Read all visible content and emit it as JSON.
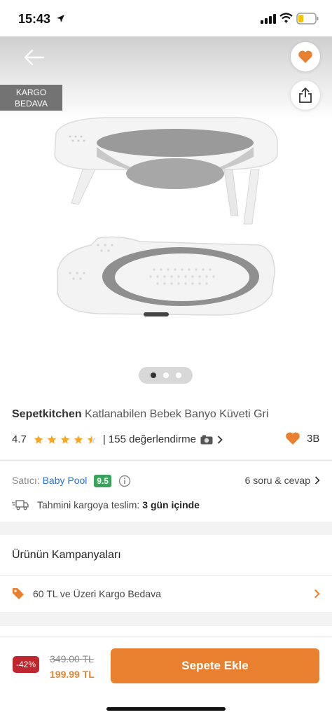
{
  "status": {
    "time": "15:43"
  },
  "hero": {
    "cargo_badge_line1": "KARGO",
    "cargo_badge_line2": "BEDAVA",
    "image_count": 3,
    "active_image": 1
  },
  "product": {
    "brand": "Sepetkitchen",
    "name": "Katlanabilen Bebek Banyo Küveti Gri",
    "rating": "4.7",
    "stars": 4.5,
    "reviews": "| 155 değerlendirme",
    "favorites": "3B"
  },
  "seller": {
    "label": "Satıcı:",
    "name": "Baby Pool",
    "score": "9.5",
    "qa_link": "6 soru & cevap"
  },
  "delivery": {
    "label": "Tahmini kargoya teslim:",
    "value": "3 gün içinde"
  },
  "campaigns": {
    "title": "Ürünün Kampanyaları",
    "items": [
      {
        "label": "60 TL ve Üzeri Kargo Bedava"
      }
    ]
  },
  "footer": {
    "discount": "-42%",
    "old_price": "349.00 TL",
    "new_price": "199.99 TL",
    "add_button": "Sepete Ekle"
  },
  "colors": {
    "accent": "#e8802f",
    "star": "#f5a623",
    "discount": "#c0262d",
    "seller_link": "#2a6fd6",
    "score": "#3aa35b"
  }
}
